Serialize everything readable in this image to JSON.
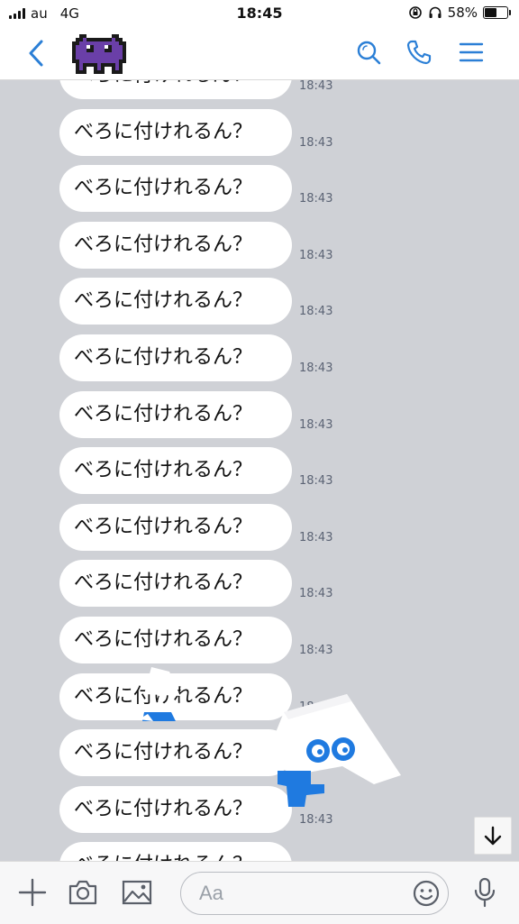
{
  "status_bar": {
    "carrier": "au",
    "network": "4G",
    "time": "18:45",
    "battery_percent": "58%",
    "battery_level": 0.58
  },
  "header": {
    "icons": [
      "chevron-left-icon",
      "pixel-monster-avatar",
      "search-icon",
      "phone-icon",
      "menu-icon"
    ],
    "accent_color": "#2b7fd6"
  },
  "messages": [
    {
      "text": "べろに付けれるん？",
      "time": "18:43"
    },
    {
      "text": "べろに付けれるん？",
      "time": "18:43"
    },
    {
      "text": "べろに付けれるん？",
      "time": "18:43"
    },
    {
      "text": "べろに付けれるん？",
      "time": "18:43"
    },
    {
      "text": "べろに付けれるん？",
      "time": "18:43"
    },
    {
      "text": "べろに付けれるん？",
      "time": "18:43"
    },
    {
      "text": "べろに付けれるん？",
      "time": "18:43"
    },
    {
      "text": "べろに付けれるん？",
      "time": "18:43"
    },
    {
      "text": "べろに付けれるん？",
      "time": "18:43"
    },
    {
      "text": "べろに付けれるん？",
      "time": "18:43"
    },
    {
      "text": "べろに付けれるん？",
      "time": "18:43"
    },
    {
      "text": "べろに付けれるん？",
      "time": "18:43"
    },
    {
      "text": "べろに付けれるん？",
      "time": "18:43"
    },
    {
      "text": "べろに付けれるん？",
      "time": "18:43"
    },
    {
      "text": "べろに付けれるん？",
      "time": "18:43"
    }
  ],
  "input": {
    "placeholder": "Aa",
    "icons": [
      "plus-icon",
      "camera-icon",
      "image-icon",
      "emoji-icon",
      "microphone-icon"
    ]
  },
  "colors": {
    "chat_background": "#cfd1d6",
    "bubble": "#ffffff",
    "avatar_purple": "#6a3fa8",
    "sticker_blue": "#1f7ae0"
  }
}
